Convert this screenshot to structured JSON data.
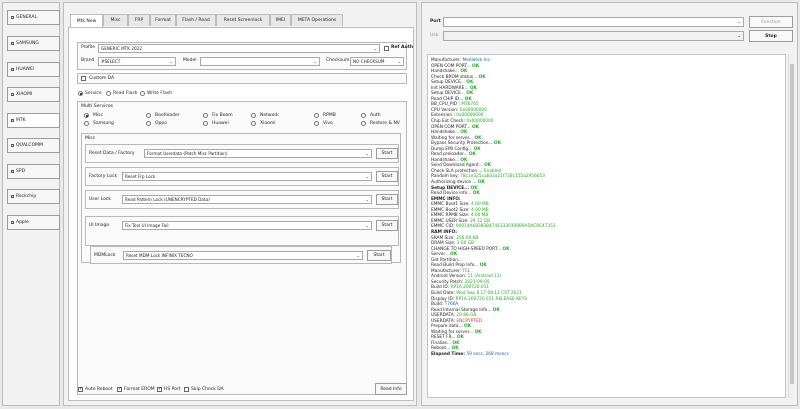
{
  "nav": [
    {
      "label": "GENERAL"
    },
    {
      "label": "SAMSUNG"
    },
    {
      "label": "HUAWEI"
    },
    {
      "label": "XIAOMI"
    },
    {
      "label": "MTK"
    },
    {
      "label": "QUALCOMM"
    },
    {
      "label": "SPD"
    },
    {
      "label": "Rockchip"
    },
    {
      "label": "Apple"
    }
  ],
  "tabs": [
    "Mtk New",
    "Misc",
    "FRP",
    "Format",
    "Flash / Read",
    "Reset Screenlock",
    "IMEI",
    "META Operations"
  ],
  "profile": {
    "label": "Profile",
    "value": "GENERIC MTK 2022",
    "ref_auth": "Ref Auth"
  },
  "brand": {
    "label": "Brand",
    "value": "#SELECT"
  },
  "model": {
    "label": "Model",
    "value": ""
  },
  "checksum": {
    "label": "Checksum",
    "value": "NO CHECKSUM"
  },
  "custom_da": "Custom DA",
  "modes": [
    "Service",
    "Read Flash",
    "Write Flash"
  ],
  "multi_services": {
    "title": "Multi Services",
    "options": [
      "Misc",
      "Bootloader",
      "Fix Boom",
      "Network",
      "RPMB",
      "Auth",
      "Samsung",
      "Oppo",
      "Huawei",
      "Xiaomi",
      "Vivo",
      "Restore & NV"
    ]
  },
  "misc": {
    "title": "Misc",
    "rows": [
      {
        "label": "Reset Data / Factory",
        "value": "Format Userdata (Patch Misc Partition)",
        "button": "Start"
      },
      {
        "label": "Factory Lock",
        "value": "Reset Frp Lock",
        "button": "Start"
      },
      {
        "label": "User Lock",
        "value": "Read Pattern Lock (UNENCRYPTED Data)",
        "button": "Start"
      },
      {
        "label": "UI Image",
        "value": "Fix Tool UI Image Fail",
        "button": "Start"
      }
    ],
    "meta_lock": {
      "label": "MDMLock",
      "value": "Reset MDM Lock INFINIX TECNO",
      "button": "Start"
    }
  },
  "bottom": {
    "auto_reboot": "Auto Reboot",
    "format_erom": "Format EROM",
    "hs_port": "HS Port",
    "skip_check_da": "Skip Check DA",
    "read_info": "Read Info"
  },
  "port": {
    "label": "Port",
    "value": "",
    "function_label": "Function"
  },
  "usb": {
    "label": "Usb",
    "value": "",
    "stop_label": "Stop"
  },
  "log": [
    {
      "t": "Manufacturer: ",
      "v": "Mediatek Inc.",
      "c": "v-b"
    },
    {
      "t": "OPEN COM PORT... ",
      "v": "OK",
      "c": "v-ok"
    },
    {
      "t": "Handshake... ",
      "v": "OK",
      "c": "v-ok"
    },
    {
      "t": "Check BROM status... ",
      "v": "OK",
      "c": "v-ok"
    },
    {
      "t": "Setup DEVICE... ",
      "v": "OK",
      "c": "v-ok"
    },
    {
      "t": "Init HARDWARE... ",
      "v": "OK",
      "c": "v-ok"
    },
    {
      "t": "Setup DEVICE... ",
      "v": "OK",
      "c": "v-ok"
    },
    {
      "t": "Read CHIP ID... ",
      "v": "OK",
      "c": "v-ok"
    },
    {
      "t": "BB_CPU_PID : ",
      "v": "MT6765",
      "c": "v-g"
    },
    {
      "t": "CPU Version: ",
      "v": "0x00000000",
      "c": "v-g"
    },
    {
      "t": "Extension : ",
      "v": "0x00000000",
      "c": "v-g"
    },
    {
      "t": "Chip Ext Check: ",
      "v": "0x00000000",
      "c": "v-g"
    },
    {
      "t": "OPEN COM PORT... ",
      "v": "OK",
      "c": "v-ok"
    },
    {
      "t": "Handshake... ",
      "v": "OK",
      "c": "v-ok"
    },
    {
      "t": "Waiting for server... ",
      "v": "OK",
      "c": "v-ok"
    },
    {
      "t": "Bypass Security Protection... ",
      "v": "OK",
      "c": "v-ok"
    },
    {
      "t": "Dump EMI Config... ",
      "v": "OK",
      "c": "v-ok"
    },
    {
      "t": "Read preloader... ",
      "v": "OK",
      "c": "v-ok"
    },
    {
      "t": "Handshake... ",
      "v": "OK",
      "c": "v-ok"
    },
    {
      "t": "Send Download Agent... ",
      "v": "OK",
      "c": "v-ok"
    },
    {
      "t": "Check SLA protection ... ",
      "v": "Enabled",
      "c": "v-g"
    },
    {
      "t": "Random key: ",
      "v": "78c1e325cab03a21f728c155a2956b53",
      "c": "v-g"
    },
    {
      "t": "Authorizing device ... ",
      "v": "OK",
      "c": "v-ok"
    },
    {
      "t": "Setup DEVICE... ",
      "v": "OK",
      "c": "v-ok",
      "bold": true
    },
    {
      "t": "Read Device info... ",
      "v": "OK",
      "c": "v-ok"
    },
    {
      "t": "EMMC INFO:",
      "v": "",
      "c": "",
      "bold": true
    },
    {
      "t": "EMMC Boot1 Size: ",
      "v": "4.00 MB",
      "c": "v-g"
    },
    {
      "t": "EMMC Boot2 Size: ",
      "v": "4.00 MB",
      "c": "v-g"
    },
    {
      "t": "EMMC RPMB Size: ",
      "v": "4.00 MB",
      "c": "v-g"
    },
    {
      "t": "EMMC USER Size: ",
      "v": "29.12 GB",
      "c": "v-g"
    },
    {
      "t": "EMMC CID: ",
      "v": "90014A68383847413330300B9A5AC0C47353",
      "c": "v-g"
    },
    {
      "t": "RAM INFO:",
      "v": "",
      "c": "",
      "bold": true
    },
    {
      "t": "SRAM Size: ",
      "v": "256.00 KB",
      "c": "v-g"
    },
    {
      "t": "DRAM Size: ",
      "v": "3.00 GB",
      "c": "v-g"
    },
    {
      "t": "CHANGE TO HIGH-SPEED PORT... ",
      "v": "OK",
      "c": "v-ok"
    },
    {
      "t": "Server... ",
      "v": "OK",
      "c": "v-ok"
    },
    {
      "t": "Get Partition... ",
      "v": "",
      "c": ""
    },
    {
      "t": "Read Build Prop Info... ",
      "v": "OK",
      "c": "v-ok"
    },
    {
      "t": "Manufacturer: ",
      "v": "TCL",
      "c": "v-g"
    },
    {
      "t": "Android Version: ",
      "v": "11 (Android 11)",
      "c": "v-g"
    },
    {
      "t": "Security Patch: ",
      "v": "2021-09-05",
      "c": "v-g"
    },
    {
      "t": "Build ID: ",
      "v": "RP1A.200720.011",
      "c": "v-g"
    },
    {
      "t": "Build Date: ",
      "v": "Wed Sep 8 17:08:12 CST 2021",
      "c": "v-g"
    },
    {
      "t": "Display ID: ",
      "v": "RP1A.200720.011 RELEASE-KEYS",
      "c": "v-g"
    },
    {
      "t": "Build: ",
      "v": "T766A",
      "c": "v-b"
    },
    {
      "t": "Read Internal Storage Info... ",
      "v": "OK",
      "c": "v-ok"
    },
    {
      "t": "USERDATA: ",
      "v": "29.88 GB",
      "c": "v-g"
    },
    {
      "t": "USERDATA: ",
      "v": "ENCRYPTED",
      "c": "v-r"
    },
    {
      "t": "Prepare data... ",
      "v": "OK",
      "c": "v-ok"
    },
    {
      "t": "Waiting for server... ",
      "v": "OK",
      "c": "v-ok"
    },
    {
      "t": "RESET FR... ",
      "v": "OK",
      "c": "v-ok"
    },
    {
      "t": "Finalize... ",
      "v": "OK",
      "c": "v-ok"
    },
    {
      "t": "Reboot... ",
      "v": "OK",
      "c": "v-ok"
    },
    {
      "t": "Elapsed Time: ",
      "v": "59 secs, 268 msecs",
      "c": "v-b",
      "bold": true
    }
  ]
}
